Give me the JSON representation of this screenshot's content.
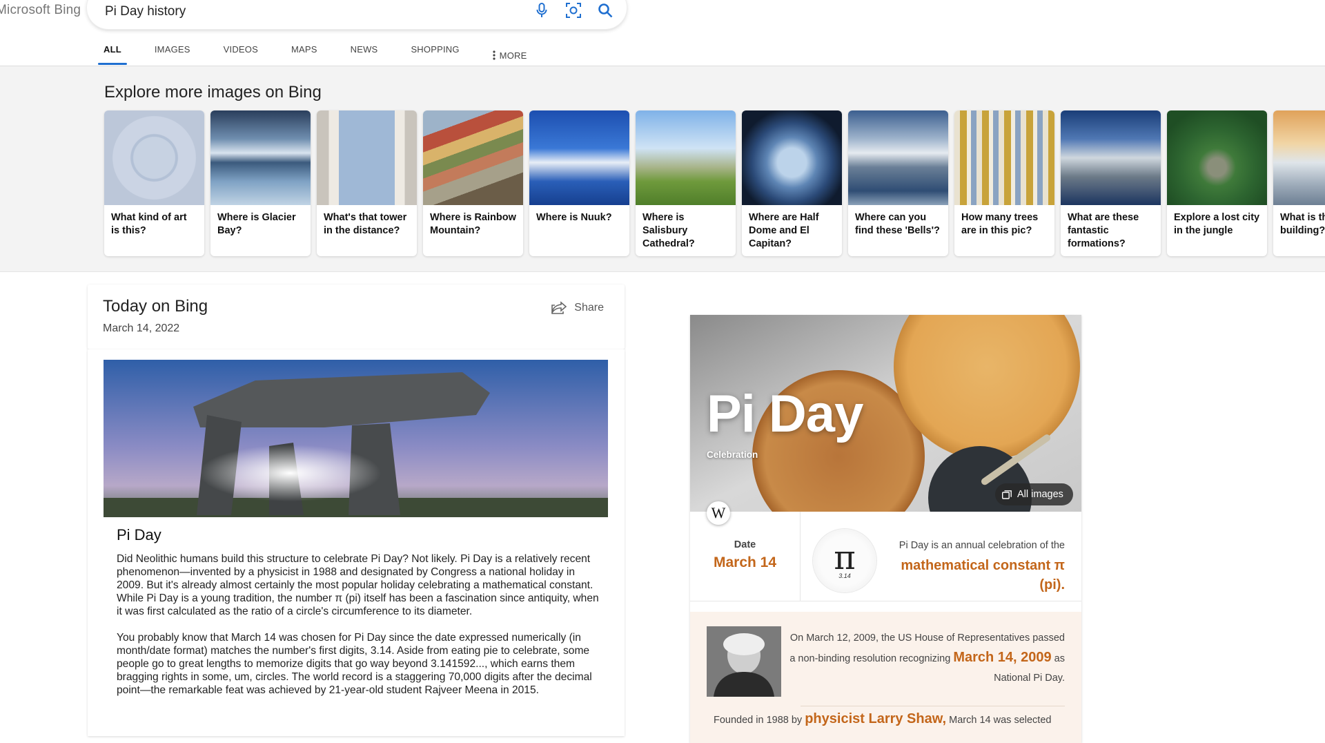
{
  "header": {
    "brand": "Microsoft Bing",
    "query": "Pi Day history"
  },
  "tabs": [
    {
      "label": "ALL"
    },
    {
      "label": "IMAGES"
    },
    {
      "label": "VIDEOS"
    },
    {
      "label": "MAPS"
    },
    {
      "label": "NEWS"
    },
    {
      "label": "SHOPPING"
    },
    {
      "label": "MORE"
    }
  ],
  "explore": {
    "title": "Explore more images on Bing",
    "cards": [
      {
        "caption": "What kind of art is this?"
      },
      {
        "caption": "Where is Glacier Bay?"
      },
      {
        "caption": "What's that tower in the distance?"
      },
      {
        "caption": "Where is Rainbow Mountain?"
      },
      {
        "caption": "Where is Nuuk?"
      },
      {
        "caption": "Where is Salisbury Cathedral?"
      },
      {
        "caption": "Where are Half Dome and El Capitan?"
      },
      {
        "caption": "Where can you find these 'Bells'?"
      },
      {
        "caption": "How many trees are in this pic?"
      },
      {
        "caption": "What are these fantastic formations?"
      },
      {
        "caption": "Explore a lost city in the jungle"
      },
      {
        "caption": "What is this building?"
      }
    ]
  },
  "today": {
    "title": "Today on Bing",
    "date": "March 14, 2022",
    "share_label": "Share",
    "article_title": "Pi Day",
    "paragraphs": [
      "Did Neolithic humans build this structure to celebrate Pi Day? Not likely. Pi Day is a relatively recent phenomenon—invented by a physicist in 1988 and designated by Congress a national holiday in 2009. But it's already almost certainly the most popular holiday celebrating a mathematical constant. While Pi Day is a young tradition, the number π (pi) itself has been a fascination since antiquity, when it was first calculated as the ratio of a circle's circumference to its diameter.",
      "You probably know that March 14 was chosen for Pi Day since the date expressed numerically (in month/date format) matches the number's first digits, 3.14. Aside from eating pie to celebrate, some people go to great lengths to memorize digits that go way beyond 3.141592..., which earns them bragging rights in some, um, circles. The world record is a staggering 70,000 digits after the decimal point—the remarkable feat was achieved by 21-year-old student Rajveer Meena in 2015."
    ]
  },
  "knowledge_panel": {
    "title": "Pi Day",
    "subtitle": "Celebration",
    "all_images_label": "All images",
    "wiki_glyph": "W",
    "date_label": "Date",
    "date_value": "March 14",
    "pi_glyph": "π",
    "pi_small": "3.14",
    "desc_prefix": "Pi Day is an annual celebration of the",
    "desc_accent": "mathematical constant π (pi).",
    "fact1_pre": "On March 12, 2009, the US House of Representatives passed a non-binding resolution recognizing",
    "fact1_accent": "March 14, 2009",
    "fact1_post": "as National Pi Day.",
    "fact2_pre": "Founded in 1988 by",
    "fact2_accent": "physicist Larry Shaw,",
    "fact2_post": "March 14 was selected"
  },
  "colors": {
    "accent_orange": "#c3661a",
    "tab_indicator": "#1f6fd0"
  }
}
